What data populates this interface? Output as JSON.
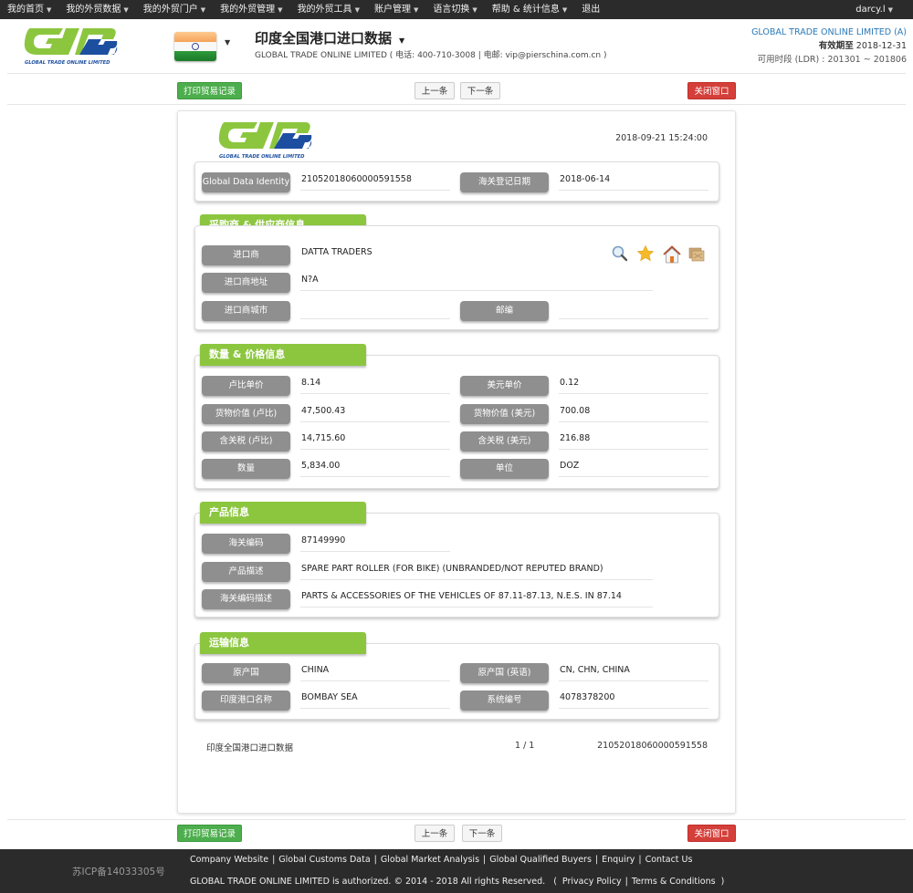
{
  "topnav": {
    "items": [
      {
        "label": "我的首页",
        "has_caret": true
      },
      {
        "label": "我的外贸数据",
        "has_caret": true
      },
      {
        "label": "我的外贸门户",
        "has_caret": true
      },
      {
        "label": "我的外贸管理",
        "has_caret": true
      },
      {
        "label": "我的外贸工具",
        "has_caret": true
      },
      {
        "label": "账户管理",
        "has_caret": true
      },
      {
        "label": "语言切换",
        "has_caret": true
      },
      {
        "label": "帮助 & 统计信息",
        "has_caret": true
      },
      {
        "label": "退出",
        "has_caret": false
      }
    ],
    "user": "darcy.l",
    "caret": "▼"
  },
  "header": {
    "logo_text": "GLOBAL TRADE ONLINE LIMITED",
    "flag": "india-flag",
    "title": "印度全国港口进口数据",
    "subtitle": "GLOBAL TRADE ONLINE LIMITED ( 电话:  400-710-3008  | 电邮:  vip@pierschina.com.cn )",
    "company": "GLOBAL TRADE ONLINE LIMITED (A)",
    "valid_label": "有效期至",
    "valid_date": "2018-12-31",
    "ldr": "可用时段 (LDR) : 201301 ~ 201806"
  },
  "toolbar": {
    "print_label": "打印贸易记录",
    "prev_label": "上一条",
    "next_label": "下一条",
    "close_label": "关闭窗口"
  },
  "record": {
    "timestamp": "2018-09-21 15:24:00",
    "identity": {
      "gdi_label": "Global Data Identity",
      "gdi_value": "21052018060000591558",
      "date_label": "海关登记日期",
      "date_value": "2018-06-14"
    },
    "sections": {
      "party": {
        "title": "采购商 & 供应商信息",
        "importer_label": "进口商",
        "importer_value": "DATTA TRADERS",
        "address_label": "进口商地址",
        "address_value": "N?A",
        "city_label": "进口商城市",
        "city_value": "",
        "zip_label": "邮编",
        "zip_value": "",
        "icons": [
          "search-icon",
          "star-icon",
          "home-icon",
          "folder-icon"
        ]
      },
      "price": {
        "title": "数量 & 价格信息",
        "rows": [
          {
            "l1": "卢比单价",
            "v1": "8.14",
            "l2": "美元单价",
            "v2": "0.12"
          },
          {
            "l1": "货物价值 (卢比)",
            "v1": "47,500.43",
            "l2": "货物价值 (美元)",
            "v2": "700.08"
          },
          {
            "l1": "含关税 (卢比)",
            "v1": "14,715.60",
            "l2": "含关税 (美元)",
            "v2": "216.88"
          },
          {
            "l1": "数量",
            "v1": "5,834.00",
            "l2": "单位",
            "v2": "DOZ"
          }
        ]
      },
      "product": {
        "title": "产品信息",
        "hs_label": "海关编码",
        "hs_value": "87149990",
        "desc_label": "产品描述",
        "desc_value": "SPARE PART ROLLER (FOR BIKE) (UNBRANDED/NOT REPUTED BRAND)",
        "hsdesc_label": "海关编码描述",
        "hsdesc_value": "PARTS & ACCESSORIES OF THE VEHICLES OF 87.11-87.13, N.E.S. IN 87.14"
      },
      "transport": {
        "title": "运输信息",
        "rows": [
          {
            "l1": "原产国",
            "v1": "CHINA",
            "l2": "原产国 (英语)",
            "v2": "CN, CHN, CHINA"
          },
          {
            "l1": "印度港口名称",
            "v1": "BOMBAY SEA",
            "l2": "系统编号",
            "v2": "4078378200"
          }
        ]
      }
    },
    "footer": {
      "dataset": "印度全国港口进口数据",
      "pager": "1 / 1",
      "id": "21052018060000591558"
    }
  },
  "footer": {
    "icp": "苏ICP备14033305号",
    "links": [
      "Company Website",
      "Global Customs Data",
      "Global Market Analysis",
      "Global Qualified Buyers",
      "Enquiry",
      "Contact Us"
    ],
    "copyright": "GLOBAL TRADE ONLINE LIMITED is authorized. © 2014 - 2018 All rights Reserved.",
    "policy_open": "(",
    "privacy": "Privacy Policy",
    "terms": "Terms & Conditions",
    "policy_close": ")",
    "separator": "|"
  },
  "colors": {
    "nav_bg": "#2b2b2b",
    "accent_green": "#8cc63f",
    "label_gray": "#8f8f8f",
    "print_green": "#4cae4c",
    "close_red": "#d43f3a",
    "company_blue": "#2a7ab8",
    "logo_blue": "#1d4fa0"
  }
}
